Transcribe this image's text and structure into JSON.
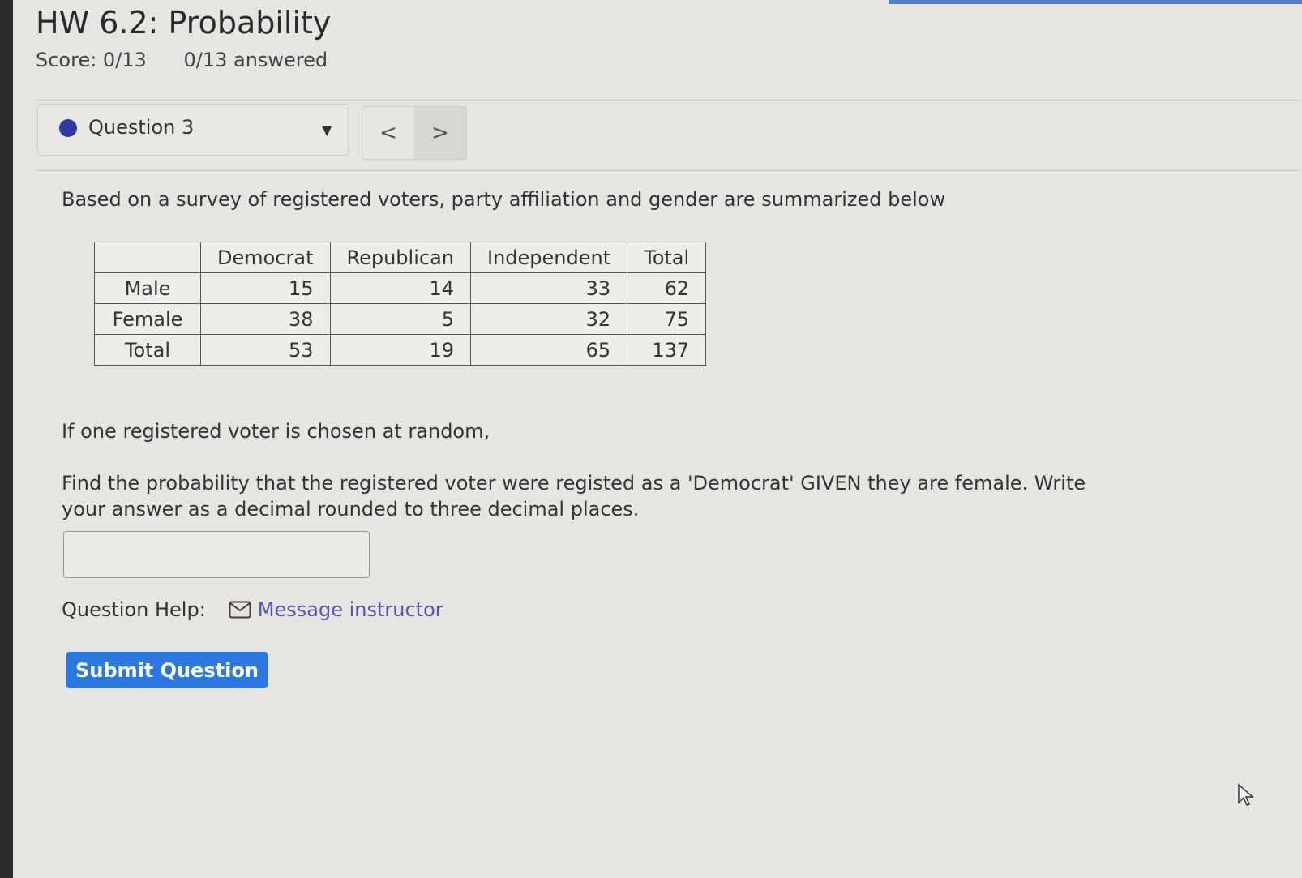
{
  "header": {
    "title": "HW 6.2: Probability",
    "score": "Score: 0/13",
    "answered": "0/13 answered"
  },
  "question_nav": {
    "selected": "Question 3",
    "prev_icon": "<",
    "next_icon": ">",
    "status_color": "#2f3aa0"
  },
  "question": {
    "intro": "Based on a survey of registered voters, party affiliation and gender are summarized below",
    "table": {
      "headers": [
        "",
        "Democrat",
        "Republican",
        "Independent",
        "Total"
      ],
      "rows": [
        [
          "Male",
          "15",
          "14",
          "33",
          "62"
        ],
        [
          "Female",
          "38",
          "5",
          "32",
          "75"
        ],
        [
          "Total",
          "53",
          "19",
          "65",
          "137"
        ]
      ]
    },
    "p1": "If one registered voter is chosen at random,",
    "p2": "Find the probability that the registered voter were registed as a 'Democrat' GIVEN they are female. Write your answer as a decimal rounded to three decimal places.",
    "answer_value": ""
  },
  "help": {
    "label": "Question Help:",
    "message_link": "Message instructor"
  },
  "submit_label": "Submit Question",
  "colors": {
    "accent": "#2a78e0",
    "link": "#5555b0"
  }
}
